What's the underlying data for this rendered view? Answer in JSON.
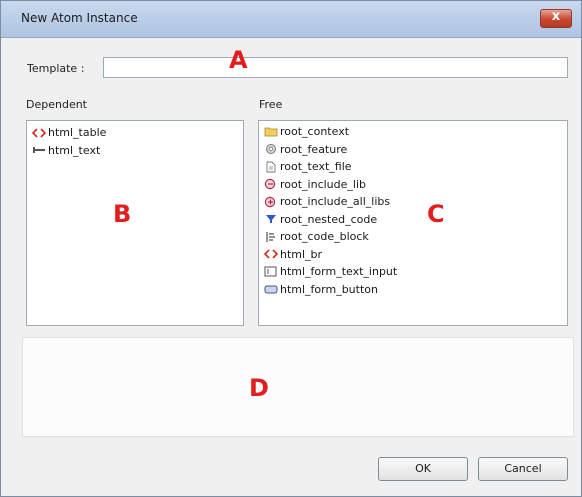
{
  "window": {
    "title": "New Atom Instance",
    "close_glyph": "x"
  },
  "template": {
    "label": "Template :",
    "value": ""
  },
  "dependent": {
    "heading": "Dependent",
    "items": [
      {
        "label": "html_table",
        "icon": "angle-brackets-icon"
      },
      {
        "label": "html_text",
        "icon": "text-abc-icon"
      }
    ]
  },
  "free": {
    "heading": "Free",
    "items": [
      {
        "label": "root_context",
        "icon": "folder-icon"
      },
      {
        "label": "root_feature",
        "icon": "feature-gear-icon"
      },
      {
        "label": "root_text_file",
        "icon": "text-file-icon"
      },
      {
        "label": "root_include_lib",
        "icon": "include-lib-icon"
      },
      {
        "label": "root_include_all_libs",
        "icon": "include-all-libs-icon"
      },
      {
        "label": "root_nested_code",
        "icon": "nested-code-funnel-icon"
      },
      {
        "label": "root_code_block",
        "icon": "code-block-icon"
      },
      {
        "label": "html_br",
        "icon": "angle-brackets-icon"
      },
      {
        "label": "html_form_text_input",
        "icon": "text-input-icon"
      },
      {
        "label": "html_form_button",
        "icon": "form-button-icon"
      }
    ]
  },
  "buttons": {
    "ok": "OK",
    "cancel": "Cancel"
  },
  "annotations": {
    "a": "A",
    "b": "B",
    "c": "C",
    "d": "D"
  },
  "colors": {
    "annotation": "#e21d1d",
    "titlebar": "#b9cde7",
    "close": "#c9462f",
    "html_icon": "#d0281f"
  }
}
